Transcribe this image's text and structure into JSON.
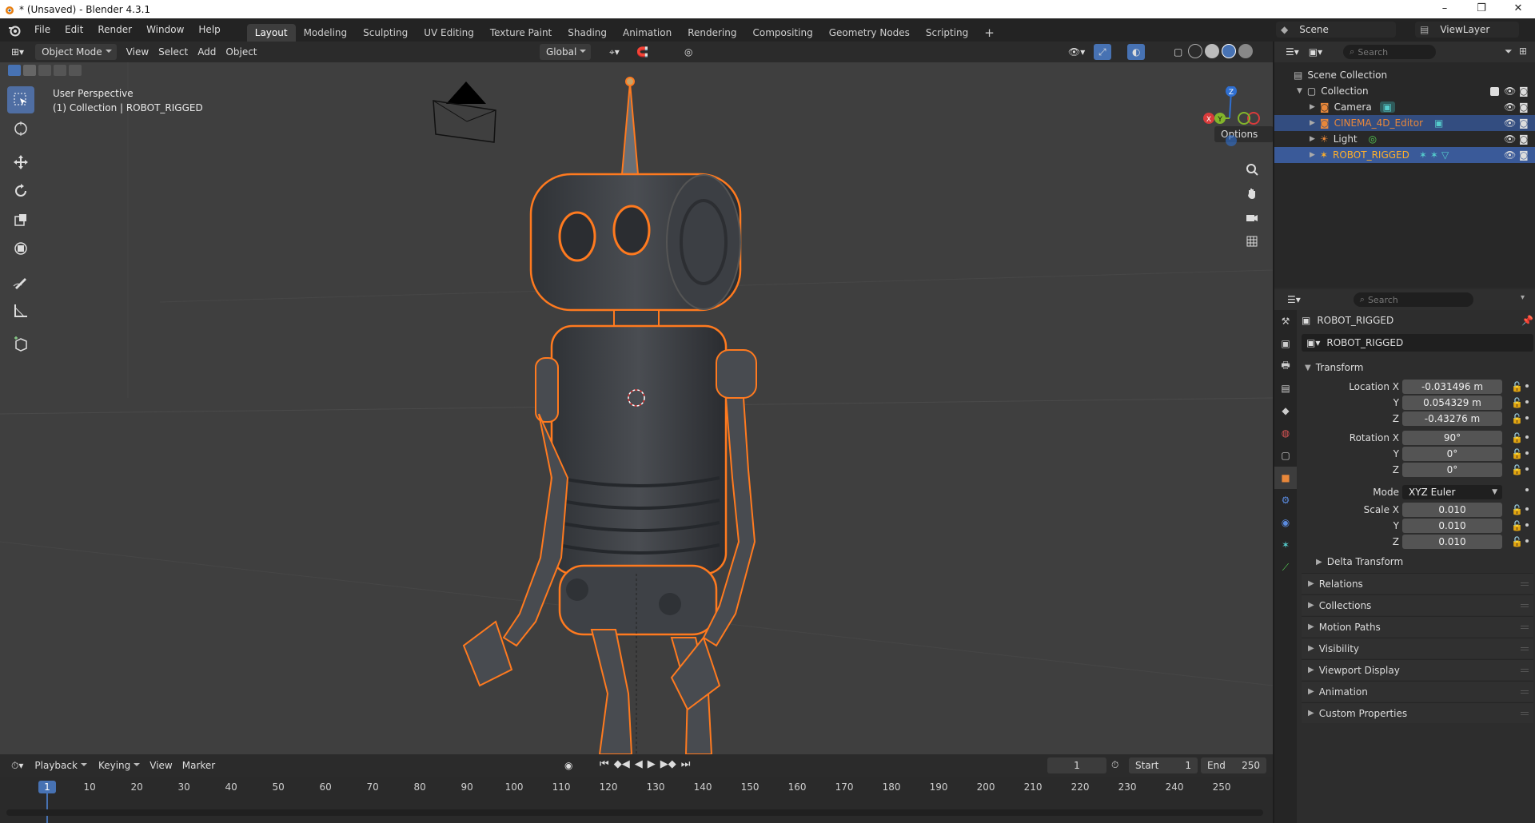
{
  "window": {
    "title": "* (Unsaved) - Blender 4.3.1"
  },
  "menu": [
    "File",
    "Edit",
    "Render",
    "Window",
    "Help"
  ],
  "workspaces": [
    "Layout",
    "Modeling",
    "Sculpting",
    "UV Editing",
    "Texture Paint",
    "Shading",
    "Animation",
    "Rendering",
    "Compositing",
    "Geometry Nodes",
    "Scripting"
  ],
  "active_workspace": "Layout",
  "scene": {
    "name": "Scene",
    "view_layer": "ViewLayer"
  },
  "viewport_header": {
    "mode": "Object Mode",
    "menus": [
      "View",
      "Select",
      "Add",
      "Object"
    ],
    "orientation": "Global",
    "options": "Options"
  },
  "viewport": {
    "perspective": "User Perspective",
    "collection_info": "(1) Collection | ROBOT_RIGGED"
  },
  "gizmo": {
    "z": "Z",
    "y": "Y",
    "x": "X"
  },
  "outliner": {
    "search_placeholder": "Search",
    "items": [
      {
        "label": "Scene Collection"
      },
      {
        "label": "Collection"
      },
      {
        "label": "Camera"
      },
      {
        "label": "CINEMA_4D_Editor"
      },
      {
        "label": "Light"
      },
      {
        "label": "ROBOT_RIGGED"
      }
    ]
  },
  "properties": {
    "search_placeholder": "Search",
    "object_name": "ROBOT_RIGGED",
    "object_field": "ROBOT_RIGGED",
    "transform_label": "Transform",
    "location_label": "Location X",
    "rotation_label": "Rotation X",
    "scale_label": "Scale X",
    "y_label": "Y",
    "z_label": "Z",
    "location": [
      "-0.031496 m",
      "0.054329 m",
      "-0.43276 m"
    ],
    "rotation": [
      "90°",
      "0°",
      "0°"
    ],
    "mode_label": "Mode",
    "mode_value": "XYZ Euler",
    "scale": [
      "0.010",
      "0.010",
      "0.010"
    ],
    "delta_transform": "Delta Transform",
    "sections": [
      "Relations",
      "Collections",
      "Motion Paths",
      "Visibility",
      "Viewport Display",
      "Animation",
      "Custom Properties"
    ]
  },
  "timeline": {
    "menus": [
      "Playback",
      "Keying",
      "View",
      "Marker"
    ],
    "current_frame": "1",
    "start_label": "Start",
    "start": "1",
    "end_label": "End",
    "end": "250",
    "playhead": "1",
    "ticks": [
      "10",
      "20",
      "30",
      "40",
      "50",
      "60",
      "70",
      "80",
      "90",
      "100",
      "110",
      "120",
      "130",
      "140",
      "150",
      "160",
      "170",
      "180",
      "190",
      "200",
      "210",
      "220",
      "230",
      "240",
      "250"
    ]
  },
  "colors": {
    "accent": "#4772b3",
    "selection_outline": "#ff7a1f",
    "viewport_bg": "#3f3f3f",
    "active_object_text": "#ffaf29"
  }
}
